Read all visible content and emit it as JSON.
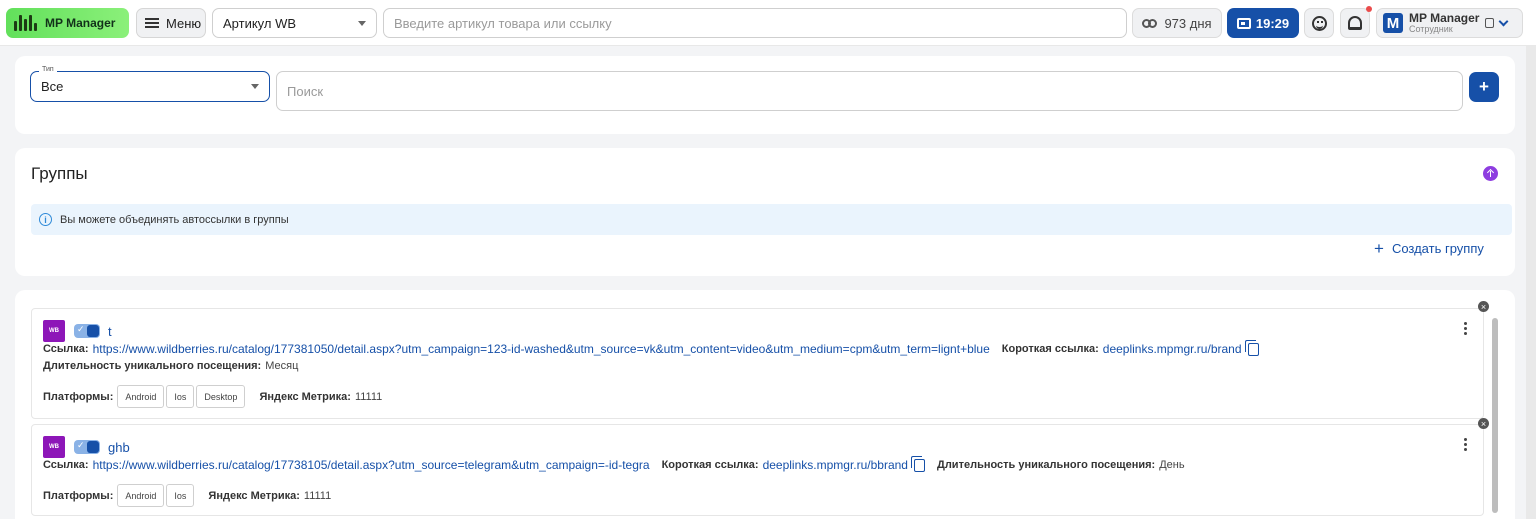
{
  "topbar": {
    "app_name": "MP Manager",
    "menu_label": "Меню",
    "article_select": "Артикул WB",
    "search_placeholder": "Введите артикул товара или ссылку",
    "days_label": "973 дня",
    "time_label": "19:29",
    "user_name": "MP Manager",
    "user_role": "Сотрудник",
    "avatar_letter": "M"
  },
  "filter": {
    "type_label": "Тип",
    "type_value": "Все",
    "search_placeholder": "Поиск",
    "add_label": "+"
  },
  "groups": {
    "title": "Группы",
    "info_text": "Вы можете объединять автоссылки в группы",
    "create_label": "Создать группу"
  },
  "labels": {
    "link": "Ссылка:",
    "short_link": "Короткая ссылка:",
    "duration": "Длительность уникального посещения:",
    "platforms": "Платформы:",
    "metrika": "Яндекс Метрика:",
    "wb": "WB"
  },
  "items": [
    {
      "name": "t",
      "url": "https://www.wildberries.ru/catalog/177381050/detail.aspx?utm_campaign=123-id-washed&utm_source=vk&utm_content=video&utm_medium=cpm&utm_term=lignt+blue",
      "short_link": "deeplinks.mpmgr.ru/brand",
      "duration": "Месяц",
      "platforms": [
        "Android",
        "Ios",
        "Desktop"
      ],
      "metrika": "11111"
    },
    {
      "name": "ghb",
      "url": "https://www.wildberries.ru/catalog/17738105/detail.aspx?utm_source=telegram&utm_campaign=-id-tegra",
      "short_link": "deeplinks.mpmgr.ru/bbrand",
      "duration": "День",
      "platforms": [
        "Android",
        "Ios"
      ],
      "metrika": "11111"
    }
  ],
  "colors": {
    "accent": "#1650a8",
    "logo_green": "#62e05b",
    "wb_purple": "#8d16b8",
    "info_bg": "#eaf4fd"
  }
}
